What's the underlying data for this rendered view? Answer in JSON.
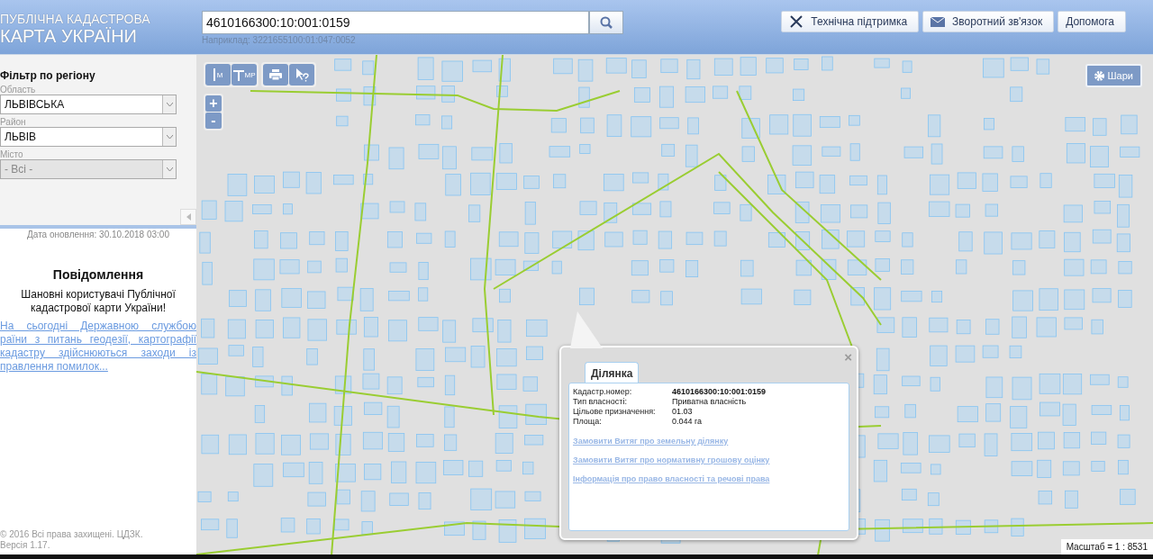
{
  "header": {
    "logo_line1": "ПУБЛІЧНА КАДАСТРОВА",
    "logo_line2": "КАРТА УКРАЇНИ",
    "search": {
      "value": "4610166300:10:001:0159",
      "hint": "Наприклад: 3221655100:01:047:0052"
    },
    "buttons": [
      {
        "kind": "support",
        "label": "Технічна підтримка"
      },
      {
        "kind": "feedback",
        "label": "Зворотний зв'язок"
      },
      {
        "kind": "help",
        "label": "Допомога"
      }
    ]
  },
  "filter": {
    "title": "Фільтр по регіону",
    "fields": [
      {
        "label": "Область",
        "value": "ЛЬВІВСЬКА",
        "disabled": false
      },
      {
        "label": "Район",
        "value": "ЛЬВІВ",
        "disabled": false
      },
      {
        "label": "Місто",
        "value": "- Всі -",
        "disabled": true
      }
    ]
  },
  "update_date": "Дата оновлення: 30.10.2018 03:00",
  "notice": {
    "title": "Повідомлення",
    "greeting": "Шановні користувачі Публічної кадастрової карти України!",
    "link_lines": [
      "На сьогодні Державною службою",
      "раїни з питань геодезії, картографії",
      "кадастру здійснюються заходи із",
      "правлення помилок..."
    ]
  },
  "footer": "© 2016 Всі права захищені. ЦДЗК. Версія 1.17.",
  "map": {
    "tools": [
      {
        "kind": "ruler",
        "glyph": "М"
      },
      {
        "kind": "area",
        "glyph": "МР"
      },
      {
        "kind": "print"
      },
      {
        "kind": "query"
      }
    ],
    "zoom_in": "+",
    "zoom_out": "-",
    "layers": "Шари",
    "scale": "Масштаб = 1 : 8531",
    "popup": {
      "close": "×",
      "tabs": [
        {
          "label": "Ділянка",
          "selected": true
        }
      ],
      "rows": [
        {
          "label": "Кадастр.номер:",
          "value": "4610166300:10:001:0159",
          "kind": "bold"
        },
        {
          "label": "Тип власності:",
          "value": "Приватна власність",
          "kind": "plain"
        },
        {
          "label": "Цільове призначення:",
          "value": "01.03",
          "kind": "plain"
        },
        {
          "label": "Площа:",
          "value": "0.044 га",
          "kind": "plain"
        }
      ],
      "links": [
        "Замовити Витяг про земельну ділянку",
        "Замовити Витяг про нормативну грошову оцінку",
        "Інформація про право власності та речові права"
      ]
    }
  }
}
